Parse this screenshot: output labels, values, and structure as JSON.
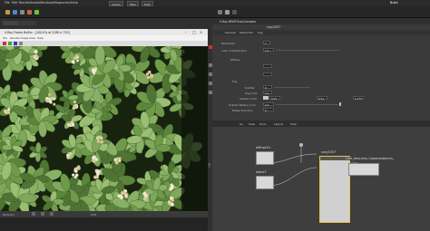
{
  "app": {
    "menu": [
      "File",
      "Edit",
      "Render",
      "Assets",
      "Windows",
      "Megascans",
      "Help"
    ],
    "desktop_label": "Build",
    "top_tabs": [
      "solaris",
      "Main",
      "Help"
    ]
  },
  "framebuffer": {
    "title": "V-Ray Frame Buffer - [100.0% of 1280 x 720]",
    "menu": [
      "File",
      "Render",
      "Image",
      "View",
      "Help"
    ],
    "status_left": "[5ms in]",
    "coords": "179"
  },
  "params": {
    "header": "V-Ray BRDFVrayComplex",
    "node_name": "vray1557",
    "tabs": [
      "General",
      "Refraction",
      "Fog"
    ],
    "rows": [
      {
        "label": "Refraction",
        "value": "1"
      },
      {
        "label": "color of Refraction",
        "value": "1.5"
      },
      {
        "label": "Diffuse",
        "value": ""
      },
      {
        "label": "",
        "value": ""
      },
      {
        "label": "Fog",
        "value": ""
      },
      {
        "label": "Scatter",
        "value": "0"
      },
      {
        "label": "Fog mult",
        "value": "0.1"
      },
      {
        "label": "Scatter Color",
        "value": "0.76"
      },
      {
        "label": "Scatter Radius (cm)",
        "value": "0.5"
      },
      {
        "label": "Phase Function",
        "value": "0"
      }
    ],
    "scatter_vals": [
      "0.91",
      "0.51",
      "0.175"
    ]
  },
  "network": {
    "tabs": [
      "Go",
      "View",
      "Tools",
      "Layout",
      "Help"
    ],
    "nodes": [
      {
        "label": "diffuse14"
      },
      {
        "label": "alpha7"
      },
      {
        "label": "vray1557"
      },
      {
        "label": "Leaf_Aesculus_hippocastanum_"
      }
    ],
    "side_label": "fps"
  },
  "colors": {
    "accent": "#e0a020",
    "node_select": "#f0c040",
    "leaf_green": "#7fa85a"
  }
}
